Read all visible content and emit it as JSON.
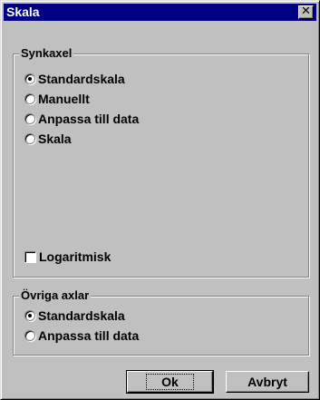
{
  "window": {
    "title": "Skala",
    "close_glyph": "✕"
  },
  "synk_group": {
    "legend": "Synkaxel",
    "options": [
      {
        "label": "Standardskala",
        "selected": true
      },
      {
        "label": "Manuellt",
        "selected": false
      },
      {
        "label": "Anpassa till data",
        "selected": false
      },
      {
        "label": "Skala",
        "selected": false
      }
    ],
    "log_checkbox": {
      "label": "Logaritmisk",
      "checked": false
    }
  },
  "other_group": {
    "legend": "Övriga axlar",
    "options": [
      {
        "label": "Standardskala",
        "selected": true
      },
      {
        "label": "Anpassa till data",
        "selected": false
      }
    ]
  },
  "buttons": {
    "ok": "Ok",
    "cancel": "Avbryt"
  }
}
